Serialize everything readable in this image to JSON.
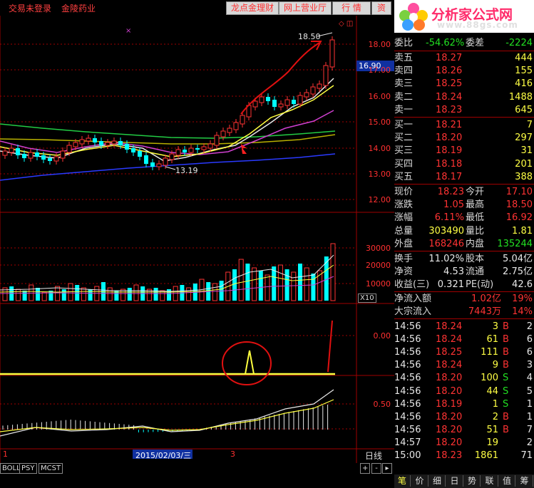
{
  "topbar": {
    "login": "交易未登录",
    "stock_name": "金陵药业",
    "buttons": [
      "龙点金理财",
      "网上营业厅",
      "行  情",
      "资"
    ]
  },
  "logo": {
    "title": "分析家公式网",
    "url": "www.88gs.com"
  },
  "price_axis": [
    "18.00",
    "17.00",
    "16.00",
    "15.00",
    "14.00",
    "13.00",
    "12.00"
  ],
  "current_price_tag": "16.90",
  "annotations": {
    "high": "18.50",
    "low": "13.19",
    "zero": "0.00",
    "half": "0.50",
    "volume_mult": "X10"
  },
  "volume_axis": [
    "30000",
    "20000",
    "10000"
  ],
  "date_bar": {
    "left": "1",
    "date": "2015/02/03/三",
    "right": "3",
    "period": "日线"
  },
  "indicator_tabs": [
    "BOLL",
    "PSY",
    "MCST"
  ],
  "scroll_buttons": [
    "+",
    "-"
  ],
  "panel": {
    "wei": {
      "l1": "委比",
      "v1": "-54.62%",
      "l2": "委差",
      "v2": "-2224"
    },
    "sell": [
      {
        "label": "卖五",
        "price": "18.27",
        "vol": "444"
      },
      {
        "label": "卖四",
        "price": "18.26",
        "vol": "155"
      },
      {
        "label": "卖三",
        "price": "18.25",
        "vol": "416"
      },
      {
        "label": "卖二",
        "price": "18.24",
        "vol": "1488"
      },
      {
        "label": "卖一",
        "price": "18.23",
        "vol": "645"
      }
    ],
    "buy": [
      {
        "label": "买一",
        "price": "18.21",
        "vol": "7"
      },
      {
        "label": "买二",
        "price": "18.20",
        "vol": "297"
      },
      {
        "label": "买三",
        "price": "18.19",
        "vol": "31"
      },
      {
        "label": "买四",
        "price": "18.18",
        "vol": "201"
      },
      {
        "label": "买五",
        "price": "18.17",
        "vol": "388"
      }
    ],
    "quote": [
      {
        "l1": "现价",
        "v1": "18.23",
        "l2": "今开",
        "v2": "17.10",
        "c1": "red",
        "c2": "red"
      },
      {
        "l1": "涨跌",
        "v1": "1.05",
        "l2": "最高",
        "v2": "18.50",
        "c1": "red",
        "c2": "red"
      },
      {
        "l1": "涨幅",
        "v1": "6.11%",
        "l2": "最低",
        "v2": "16.92",
        "c1": "red",
        "c2": "red"
      },
      {
        "l1": "总量",
        "v1": "303490",
        "l2": "量比",
        "v2": "1.81",
        "c1": "yellow",
        "c2": "yellow"
      },
      {
        "l1": "外盘",
        "v1": "168246",
        "l2": "内盘",
        "v2": "135244",
        "c1": "red",
        "c2": "green"
      }
    ],
    "fund": [
      {
        "l1": "换手",
        "v1": "11.02%",
        "l2": "股本",
        "v2": "5.04亿"
      },
      {
        "l1": "净资",
        "v1": "4.53",
        "l2": "流通",
        "v2": "2.75亿"
      },
      {
        "l1": "收益(三)",
        "v1": "0.321",
        "l2": "PE(动)",
        "v2": "42.6"
      }
    ],
    "flow": [
      {
        "label": "净流入额",
        "value": "1.02亿",
        "pct": "19%"
      },
      {
        "label": "大宗流入",
        "value": "7443万",
        "pct": "14%"
      }
    ],
    "ticks": [
      {
        "time": "14:56",
        "price": "18.24",
        "vol": "3",
        "bs": "B",
        "n": "2"
      },
      {
        "time": "14:56",
        "price": "18.24",
        "vol": "61",
        "bs": "B",
        "n": "6"
      },
      {
        "time": "14:56",
        "price": "18.25",
        "vol": "111",
        "bs": "B",
        "n": "6"
      },
      {
        "time": "14:56",
        "price": "18.24",
        "vol": "9",
        "bs": "B",
        "n": "3"
      },
      {
        "time": "14:56",
        "price": "18.20",
        "vol": "100",
        "bs": "S",
        "n": "4"
      },
      {
        "time": "14:56",
        "price": "18.20",
        "vol": "44",
        "bs": "S",
        "n": "5"
      },
      {
        "time": "14:56",
        "price": "18.19",
        "vol": "1",
        "bs": "S",
        "n": "1"
      },
      {
        "time": "14:56",
        "price": "18.20",
        "vol": "2",
        "bs": "B",
        "n": "1"
      },
      {
        "time": "14:56",
        "price": "18.20",
        "vol": "51",
        "bs": "B",
        "n": "7"
      },
      {
        "time": "14:57",
        "price": "18.20",
        "vol": "19",
        "bs": "",
        "n": "2"
      },
      {
        "time": "15:00",
        "price": "18.23",
        "vol": "1861",
        "bs": "",
        "n": "71"
      }
    ],
    "tabs": [
      "笔",
      "价",
      "细",
      "日",
      "势",
      "联",
      "值",
      "筹"
    ]
  },
  "colors": {
    "up": "#ff3333",
    "down": "#00ffff",
    "bg": "#000000",
    "grid": "#a00000"
  }
}
